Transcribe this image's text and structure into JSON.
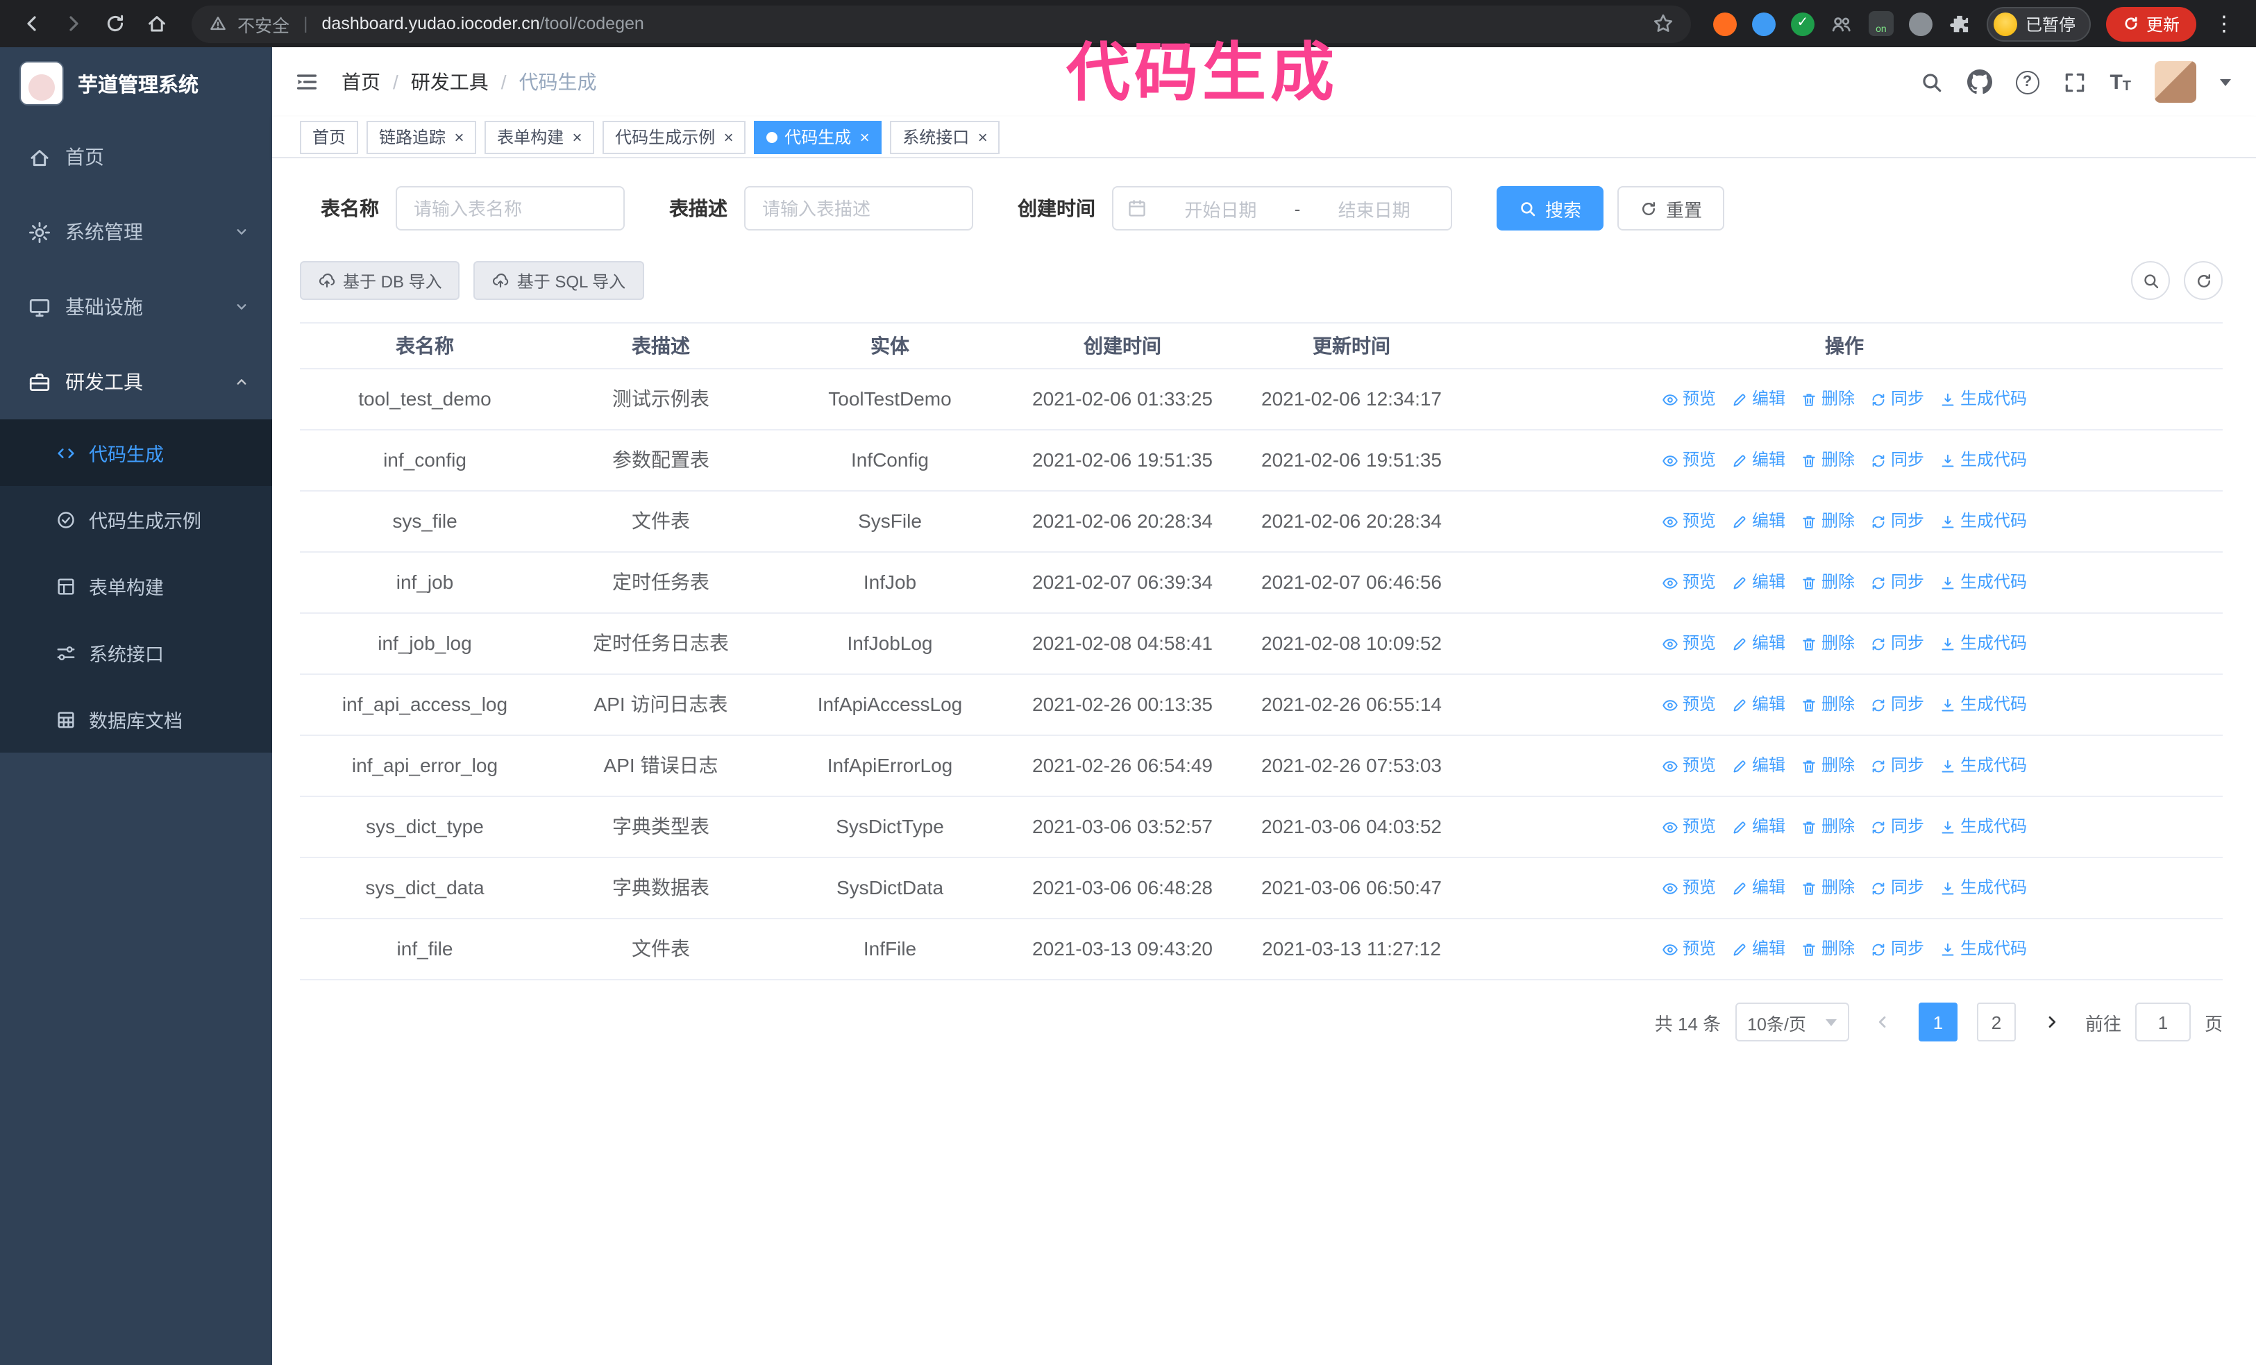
{
  "overlay_title": "代码生成",
  "browser": {
    "security_label": "不安全",
    "url_host": "dashboard.yudao.iocoder.cn",
    "url_path": "/tool/codegen",
    "extension_on_badge": "on",
    "profile_badge": "已暂停",
    "update_button": "更新"
  },
  "sidebar": {
    "logo_title": "芋道管理系统",
    "items": [
      {
        "label": "首页",
        "icon": "home-icon"
      },
      {
        "label": "系统管理",
        "icon": "gear-icon"
      },
      {
        "label": "基础设施",
        "icon": "monitor-icon"
      },
      {
        "label": "研发工具",
        "icon": "toolbox-icon",
        "expanded": true
      }
    ],
    "submenu": [
      {
        "label": "代码生成",
        "icon": "code-icon",
        "active": true
      },
      {
        "label": "代码生成示例",
        "icon": "check-badge-icon"
      },
      {
        "label": "表单构建",
        "icon": "form-grid-icon"
      },
      {
        "label": "系统接口",
        "icon": "sliders-icon"
      },
      {
        "label": "数据库文档",
        "icon": "table-grid-icon"
      }
    ]
  },
  "header": {
    "breadcrumb": [
      "首页",
      "研发工具",
      "代码生成"
    ]
  },
  "tabs": [
    {
      "label": "首页",
      "closable": false
    },
    {
      "label": "链路追踪"
    },
    {
      "label": "表单构建"
    },
    {
      "label": "代码生成示例"
    },
    {
      "label": "代码生成",
      "active": true
    },
    {
      "label": "系统接口"
    }
  ],
  "filters": {
    "table_name_label": "表名称",
    "table_name_placeholder": "请输入表名称",
    "table_desc_label": "表描述",
    "table_desc_placeholder": "请输入表描述",
    "create_time_label": "创建时间",
    "date_start_placeholder": "开始日期",
    "date_separator": "-",
    "date_end_placeholder": "结束日期",
    "search_button": "搜索",
    "reset_button": "重置"
  },
  "toolbar": {
    "import_db": "基于 DB 导入",
    "import_sql": "基于 SQL 导入"
  },
  "table": {
    "columns": [
      "表名称",
      "表描述",
      "实体",
      "创建时间",
      "更新时间",
      "操作"
    ],
    "actions": [
      "预览",
      "编辑",
      "删除",
      "同步",
      "生成代码"
    ],
    "rows": [
      {
        "name": "tool_test_demo",
        "desc": "测试示例表",
        "entity": "ToolTestDemo",
        "created": "2021-02-06 01:33:25",
        "updated": "2021-02-06 12:34:17"
      },
      {
        "name": "inf_config",
        "desc": "参数配置表",
        "entity": "InfConfig",
        "created": "2021-02-06 19:51:35",
        "updated": "2021-02-06 19:51:35"
      },
      {
        "name": "sys_file",
        "desc": "文件表",
        "entity": "SysFile",
        "created": "2021-02-06 20:28:34",
        "updated": "2021-02-06 20:28:34"
      },
      {
        "name": "inf_job",
        "desc": "定时任务表",
        "entity": "InfJob",
        "created": "2021-02-07 06:39:34",
        "updated": "2021-02-07 06:46:56"
      },
      {
        "name": "inf_job_log",
        "desc": "定时任务日志表",
        "entity": "InfJobLog",
        "created": "2021-02-08 04:58:41",
        "updated": "2021-02-08 10:09:52"
      },
      {
        "name": "inf_api_access_log",
        "desc": "API 访问日志表",
        "entity": "InfApiAccessLog",
        "created": "2021-02-26 00:13:35",
        "updated": "2021-02-26 06:55:14"
      },
      {
        "name": "inf_api_error_log",
        "desc": "API 错误日志",
        "entity": "InfApiErrorLog",
        "created": "2021-02-26 06:54:49",
        "updated": "2021-02-26 07:53:03"
      },
      {
        "name": "sys_dict_type",
        "desc": "字典类型表",
        "entity": "SysDictType",
        "created": "2021-03-06 03:52:57",
        "updated": "2021-03-06 04:03:52"
      },
      {
        "name": "sys_dict_data",
        "desc": "字典数据表",
        "entity": "SysDictData",
        "created": "2021-03-06 06:48:28",
        "updated": "2021-03-06 06:50:47"
      },
      {
        "name": "inf_file",
        "desc": "文件表",
        "entity": "InfFile",
        "created": "2021-03-13 09:43:20",
        "updated": "2021-03-13 11:27:12"
      }
    ]
  },
  "pagination": {
    "total": "共 14 条",
    "page_size": "10条/页",
    "pages": [
      {
        "label": "1",
        "active": true
      },
      {
        "label": "2"
      }
    ],
    "goto_label": "前往",
    "goto_value": "1",
    "goto_suffix": "页"
  },
  "colors": {
    "accent": "#409eff",
    "overlay": "#fa4190",
    "sidebar_bg": "#304156",
    "submenu_bg": "#1f2d3d"
  }
}
